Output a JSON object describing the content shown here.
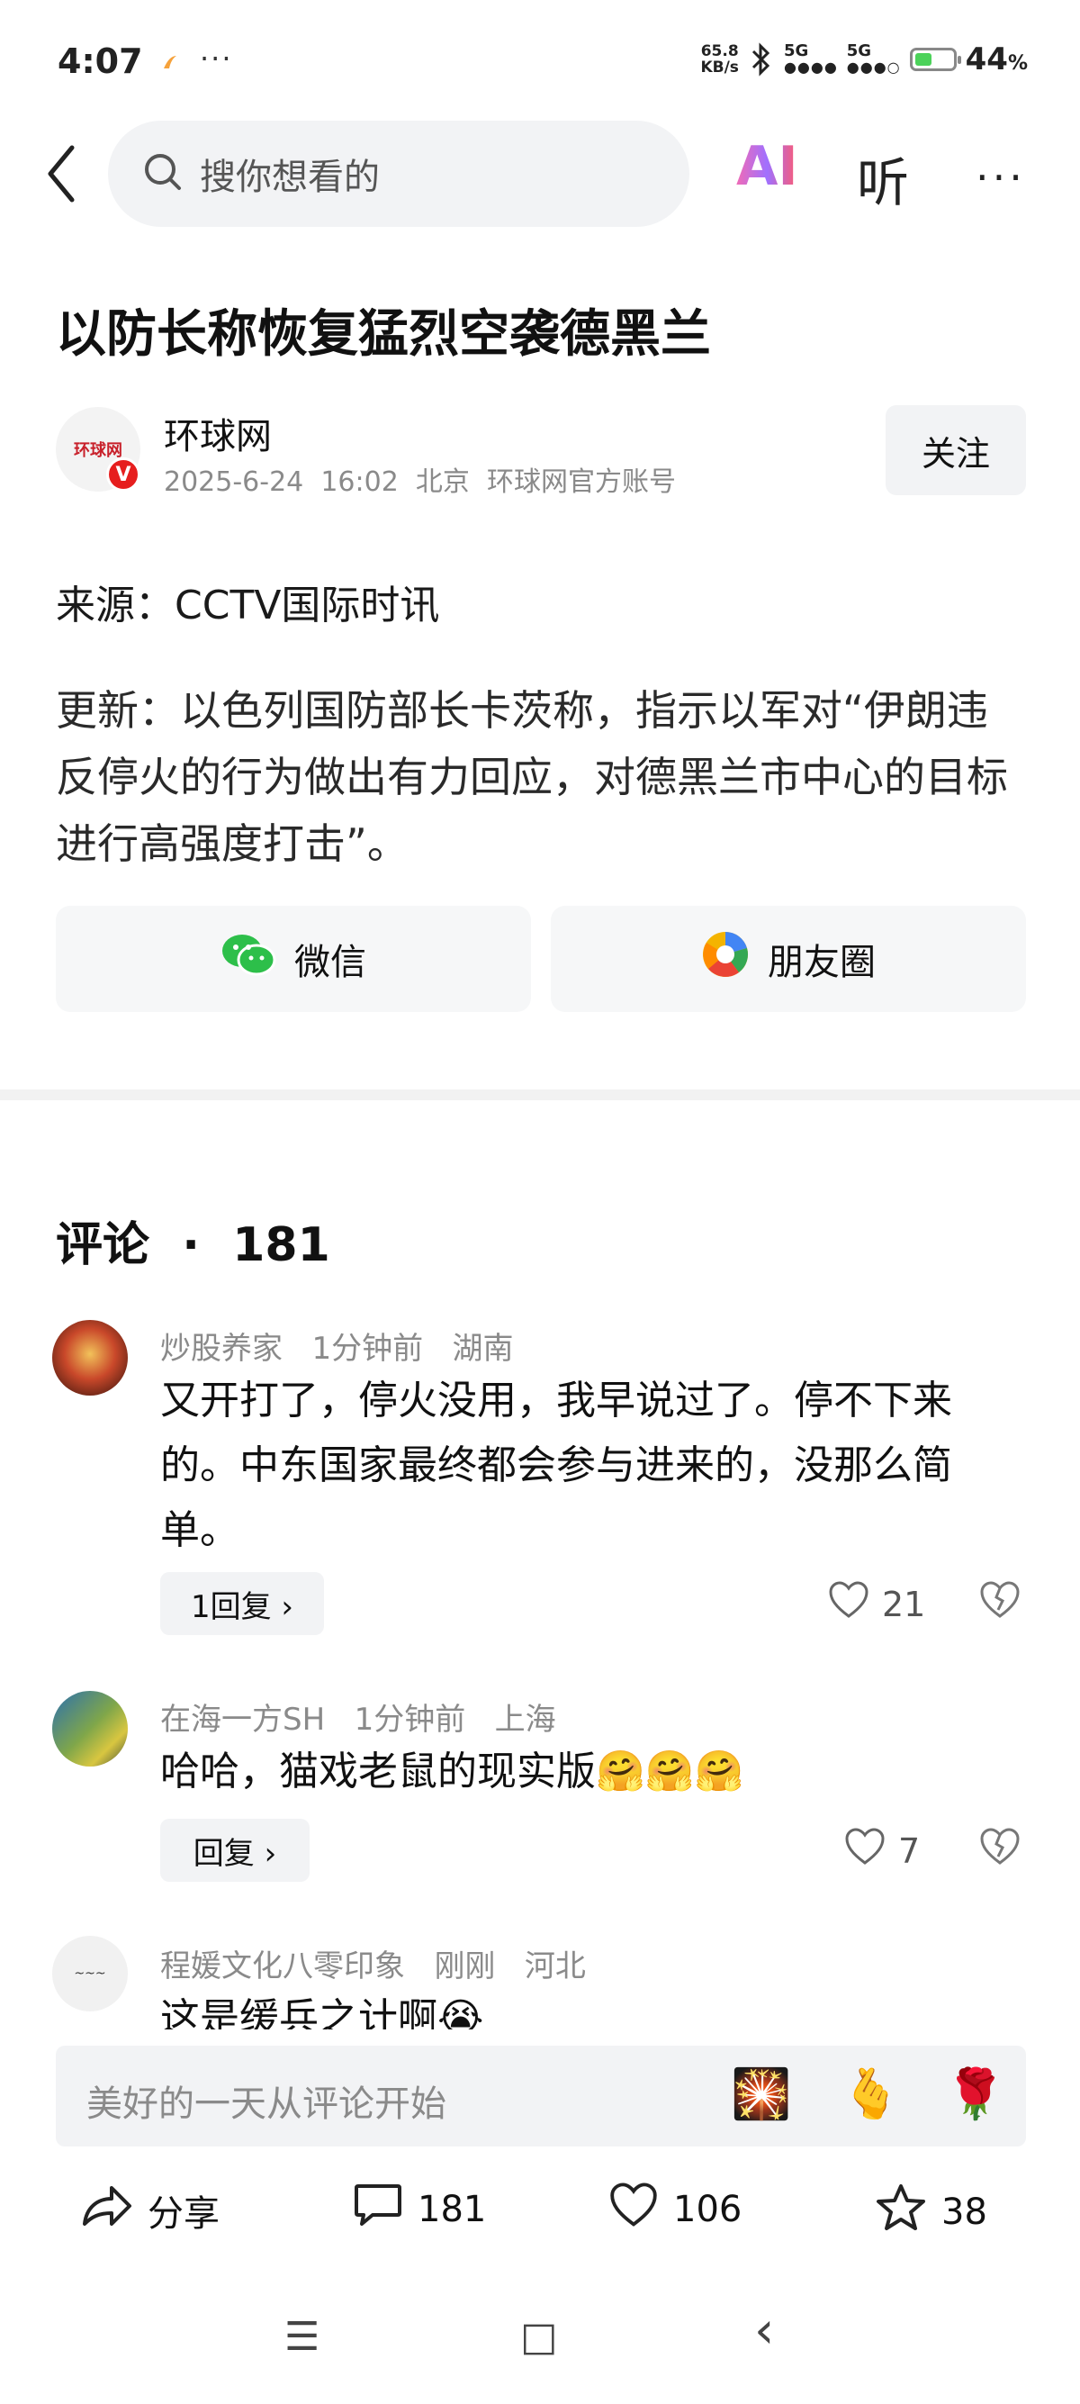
{
  "status_bar": {
    "time": "4:07",
    "dots": "···",
    "net_speed_top": "65.8",
    "net_speed_bottom": "KB/s",
    "sig1_label": "5G",
    "sig2_label": "5G",
    "battery_value": "44",
    "battery_unit": "%",
    "battery_level": 0.44
  },
  "top_bar": {
    "search_placeholder": "搜你想看的",
    "ai_label": "AI",
    "listen_label": "听",
    "more_label": "···"
  },
  "article": {
    "title": "以防长称恢复猛烈空袭德黑兰",
    "author": {
      "name": "环球网",
      "logo_text": "环球网",
      "badge": "V",
      "date": "2025-6-24",
      "time": "16:02",
      "location": "北京",
      "account_type": "环球网官方账号"
    },
    "follow_label": "关注",
    "source": "来源：CCTV国际时讯",
    "body": "更新：以色列国防部长卡茨称，指示以军对“伊朗违反停火的行为做出有力回应，对德黑兰市中心的目标进行高强度打击”。"
  },
  "share_buttons": {
    "wechat": "微信",
    "moments": "朋友圈"
  },
  "comments": {
    "title": "评论",
    "separator": "·",
    "count": "181",
    "items": [
      {
        "user": "炒股养家",
        "time": "1分钟前",
        "location": "湖南",
        "text": "又开打了，停火没用，我早说过了。停不下来的。中东国家最终都会参与进来的，没那么简单。",
        "reply_label": "1回复 ›",
        "likes": "21"
      },
      {
        "user": "在海一方SH",
        "time": "1分钟前",
        "location": "上海",
        "text": "哈哈，猫戏老鼠的现实版🤗🤗🤗",
        "reply_label": "回复 ›",
        "likes": "7"
      },
      {
        "user": "程媛文化八零印象",
        "time": "刚刚",
        "location": "河北",
        "text": "这是缓兵之计啊😭"
      }
    ]
  },
  "input_bar": {
    "placeholder": "美好的一天从评论开始",
    "emojis": [
      "🎇",
      "🫰",
      "🌹"
    ]
  },
  "bottom_actions": {
    "share": "分享",
    "comments": "181",
    "likes": "106",
    "favorites": "38"
  },
  "nav_bar": {
    "menu_icon": "☰",
    "home_icon": "□",
    "back_icon": "‹"
  }
}
